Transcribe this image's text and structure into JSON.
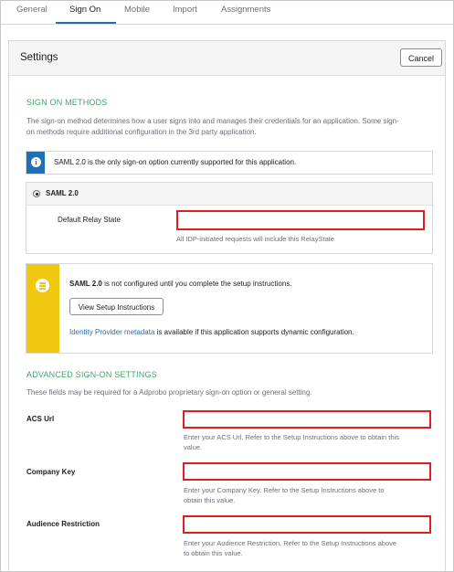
{
  "tabs": [
    {
      "label": "General"
    },
    {
      "label": "Sign On"
    },
    {
      "label": "Mobile"
    },
    {
      "label": "Import"
    },
    {
      "label": "Assignments"
    }
  ],
  "active_tab": "Sign On",
  "panel": {
    "title": "Settings",
    "cancel_label": "Cancel"
  },
  "sign_on_methods": {
    "heading": "SIGN ON METHODS",
    "description_line1": "The sign-on method determines how a user signs into and manages their credentials for an application. Some sign-",
    "description_line2": "on methods require additional configuration in the 3rd party application.",
    "info_text": "SAML 2.0 is the only sign-on option currently supported for this application.",
    "option_label": "SAML 2.0",
    "relay_state_label": "Default Relay State",
    "relay_state_value": "",
    "relay_state_help": "All IDP-initiated requests will include this RelayState"
  },
  "setup_notice": {
    "bold": "SAML 2.0",
    "text": " is not configured until you complete the setup instructions.",
    "button_label": "View Setup Instructions",
    "link_text": "Identity Provider metadata",
    "after_link": " is available if this application supports dynamic configuration."
  },
  "advanced": {
    "heading": "ADVANCED SIGN-ON SETTINGS",
    "description": "These fields may be required for a Adprobo proprietary sign-on option or general setting.",
    "fields": [
      {
        "label": "ACS Url",
        "value": "",
        "help1": "Enter your ACS Url. Refer to the Setup Instructions above to obtain this",
        "help2": "value."
      },
      {
        "label": "Company Key",
        "value": "",
        "help1": "Enter your Company Key. Refer to the Setup Instructions above to",
        "help2": "obtain this value."
      },
      {
        "label": "Audience Restriction",
        "value": "",
        "help1": "Enter your Audience Restriction. Refer to the Setup Instructions above",
        "help2": "to obtain this value."
      }
    ]
  },
  "colors": {
    "accent_blue": "#1f6fb5",
    "section_green": "#46a26e",
    "warning_yellow": "#f0c80f",
    "highlight_red": "#e01e1e"
  },
  "icons": {
    "info": "info-icon",
    "notice": "list-icon"
  }
}
